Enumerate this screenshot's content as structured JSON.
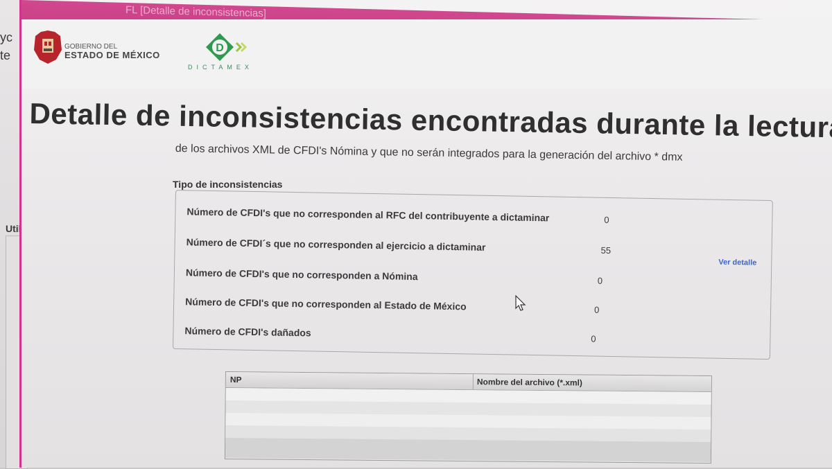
{
  "background_window": {
    "text_1": "yc",
    "text_2": "te",
    "text_3": "Utilic"
  },
  "window": {
    "title": "FL [Detalle de inconsistencias]"
  },
  "header": {
    "gobierno_line1": "GOBIERNO DEL",
    "gobierno_line2": "ESTADO DE MÉXICO",
    "dictamex_letter": "D",
    "dictamex_text": "DICTAMEX"
  },
  "page": {
    "title": "Detalle de inconsistencias encontradas durante la lectura m",
    "subtitle": "de los archivos XML de CFDI's Nómina y que no serán integrados para la generación del archivo * dmx"
  },
  "inconsistencias": {
    "legend": "Tipo de inconsistencias",
    "rows": [
      {
        "label": "Número de CFDI's que no corresponden al RFC del contribuyente a dictaminar",
        "count": "0"
      },
      {
        "label": "Número de CFDI´s que no corresponden al ejercicio a dictaminar",
        "count": "55"
      },
      {
        "label": "Número de CFDI's que no corresponden a Nómina",
        "count": "0"
      },
      {
        "label": "Número de CFDI's que no corresponden al Estado de México",
        "count": "0"
      },
      {
        "label": "Número de CFDI's dañados",
        "count": "0"
      }
    ],
    "ver_detalle": "Ver detalle"
  },
  "grid": {
    "columns": [
      "NP",
      "Nombre del archivo (*.xml)"
    ]
  },
  "colors": {
    "titlebar": "#c8397f",
    "link": "#3d66c8",
    "logo_red": "#b8242b",
    "logo_green": "#2e9a4f"
  }
}
